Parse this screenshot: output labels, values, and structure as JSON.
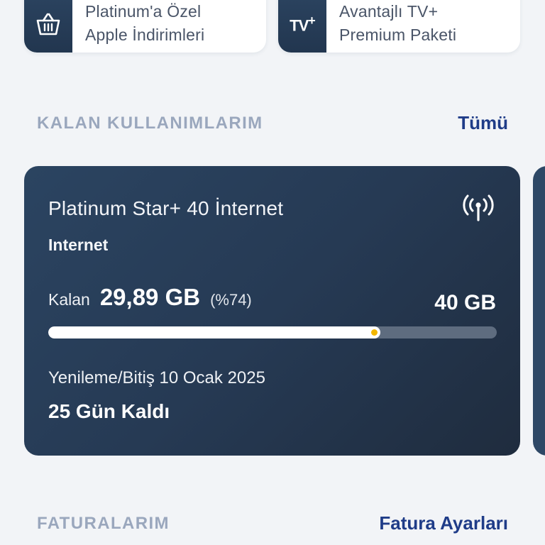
{
  "promos": [
    {
      "icon": "shopping-basket-icon",
      "line1": "Platinum'a Özel",
      "line2": "Apple İndirimleri"
    },
    {
      "icon": "tv-plus-icon",
      "icon_text": "TV",
      "icon_sup": "+",
      "line1": "Avantajlı TV+",
      "line2": "Premium Paketi"
    }
  ],
  "usage_section": {
    "title": "KALAN KULLANIMLARIM",
    "link": "Tümü"
  },
  "usage_card": {
    "plan_name": "Platinum Star+ 40 İnternet",
    "type": "Internet",
    "remaining_label": "Kalan",
    "remaining_value": "29,89 GB",
    "remaining_percent_text": "(%74)",
    "total": "40 GB",
    "progress_fraction": 0.74,
    "renew_text": "Yenileme/Bitiş 10 Ocak 2025",
    "days_left": "25 Gün Kaldı",
    "icon": "antenna-signal-icon"
  },
  "bills_section": {
    "title": "FATURALARIM",
    "link": "Fatura Ayarları"
  },
  "colors": {
    "accent": "#1f3c88",
    "card_dark": "#263a54",
    "progress_dot": "#f2b600"
  }
}
